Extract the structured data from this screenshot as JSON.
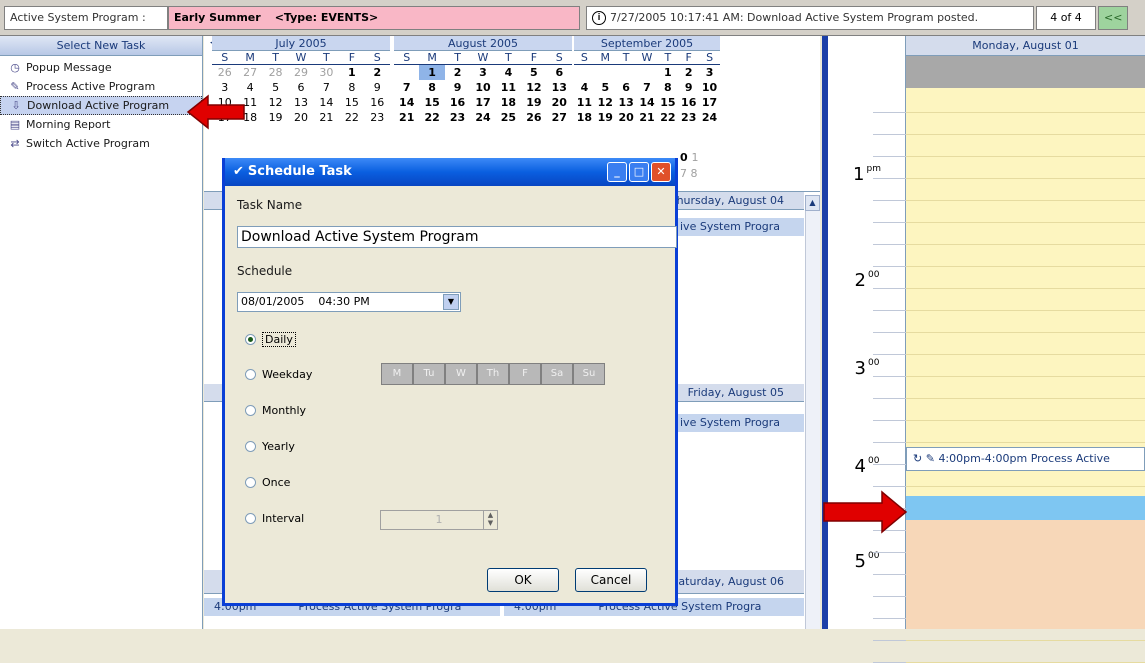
{
  "topbar": {
    "program_label": "Active System Program :",
    "event_name": "Early Summer",
    "event_type": "<Type: EVENTS>",
    "status_icon": "info-icon",
    "status_text": "7/27/2005 10:17:41 AM: Download Active System Program posted.",
    "page_count": "4 of 4",
    "back_label": "<<"
  },
  "taskpane": {
    "header": "Select New Task",
    "items": [
      {
        "label": "Popup Message",
        "icon": "popup-icon"
      },
      {
        "label": "Process Active Program",
        "icon": "process-icon"
      },
      {
        "label": "Download Active Program",
        "icon": "download-icon"
      },
      {
        "label": "Morning Report",
        "icon": "report-icon"
      },
      {
        "label": "Switch Active Program",
        "icon": "switch-icon"
      }
    ]
  },
  "calendars": {
    "months": [
      {
        "title": "July 2005",
        "dow": [
          "S",
          "M",
          "T",
          "W",
          "T",
          "F",
          "S"
        ],
        "rows": [
          [
            "26",
            "27",
            "28",
            "29",
            "30",
            "1",
            "2"
          ],
          [
            "3",
            "4",
            "5",
            "6",
            "7",
            "8",
            "9"
          ],
          [
            "10",
            "11",
            "12",
            "13",
            "14",
            "15",
            "16"
          ],
          [
            "17",
            "18",
            "19",
            "20",
            "21",
            "22",
            "23"
          ]
        ]
      },
      {
        "title": "August 2005",
        "dow": [
          "S",
          "M",
          "T",
          "W",
          "T",
          "F",
          "S"
        ],
        "rows": [
          [
            "",
            "1",
            "2",
            "3",
            "4",
            "5",
            "6"
          ],
          [
            "7",
            "8",
            "9",
            "10",
            "11",
            "12",
            "13"
          ],
          [
            "14",
            "15",
            "16",
            "17",
            "18",
            "19",
            "20"
          ],
          [
            "21",
            "22",
            "23",
            "24",
            "25",
            "26",
            "27"
          ]
        ]
      },
      {
        "title": "September 2005",
        "dow": [
          "S",
          "M",
          "T",
          "W",
          "T",
          "F",
          "S"
        ],
        "rows": [
          [
            "",
            "",
            "",
            "",
            "1",
            "2",
            "3"
          ],
          [
            "4",
            "5",
            "6",
            "7",
            "8",
            "9",
            "10"
          ],
          [
            "11",
            "12",
            "13",
            "14",
            "15",
            "16",
            "17"
          ],
          [
            "18",
            "19",
            "20",
            "21",
            "22",
            "23",
            "24"
          ]
        ]
      }
    ],
    "partial": [
      "0",
      "1",
      "7",
      "8"
    ]
  },
  "dayarea": {
    "thu_header": "Thursday, August 04",
    "thu_event": "ive System Progra",
    "fri_header": "Friday, August 05",
    "fri_event": "ive System Progra",
    "sat_header": "Saturday, August 06",
    "bottom_event_time": "4:00pm",
    "bottom_event_text": "Process Active System Progra",
    "bottom_event_time2": "4:00pm",
    "bottom_event_text2": "Process Active System Progra",
    "row_frags": [
      "8",
      "8",
      "4",
      "4"
    ]
  },
  "dayview": {
    "header": "Monday, August 01",
    "hours": [
      {
        "label": "1",
        "suffix": "pm"
      },
      {
        "label": "2",
        "suffix": "00"
      },
      {
        "label": "3",
        "suffix": "00"
      },
      {
        "label": "4",
        "suffix": "00"
      },
      {
        "label": "5",
        "suffix": "00"
      }
    ],
    "event": "4:00pm-4:00pm Process Active"
  },
  "dialog": {
    "title": "Schedule Task",
    "task_name_label": "Task Name",
    "task_name_value": "Download Active System Program",
    "schedule_label": "Schedule",
    "schedule_date": "08/01/2005",
    "schedule_time": "04:30 PM",
    "options": [
      "Daily",
      "Weekday",
      "Monthly",
      "Yearly",
      "Once",
      "Interval"
    ],
    "selected_option": "Daily",
    "weekdays": [
      "M",
      "Tu",
      "W",
      "Th",
      "F",
      "Sa",
      "Su"
    ],
    "interval_value": "1",
    "ok_label": "OK",
    "cancel_label": "Cancel"
  },
  "colors": {
    "event_bar": "#f9b7c6",
    "title_bar": "#0a5fe0",
    "arrow": "#e00000",
    "day_bg": "#fdf5c0",
    "selected_slot": "#7ec6f2"
  }
}
